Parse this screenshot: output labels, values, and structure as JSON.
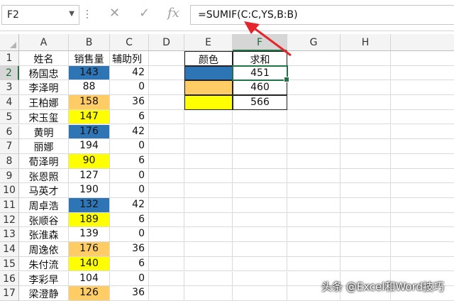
{
  "name_box": "F2",
  "formula": "=SUMIF(C:C,YS,B:B)",
  "formula_icons": {
    "cancel": "✕",
    "enter": "✓",
    "function": "fx"
  },
  "columns": [
    "A",
    "B",
    "C",
    "D",
    "E",
    "F",
    "G",
    "H"
  ],
  "rows": [
    1,
    2,
    3,
    4,
    5,
    6,
    7,
    8,
    9,
    10,
    11,
    12,
    13,
    14,
    15,
    16,
    17
  ],
  "colors": {
    "blue": "#2e75b6",
    "orange": "#ffcc66",
    "yellow": "#ffff00",
    "selection": "#217346"
  },
  "table_main": {
    "headers": [
      "姓名",
      "销售量",
      "辅助列"
    ],
    "rows": [
      {
        "name": "杨国忠",
        "sales": "143",
        "aux": "42",
        "fill": "blue"
      },
      {
        "name": "李泽明",
        "sales": "88",
        "aux": "0",
        "fill": ""
      },
      {
        "name": "王柏娜",
        "sales": "158",
        "aux": "36",
        "fill": "orange"
      },
      {
        "name": "宋玉玺",
        "sales": "147",
        "aux": "6",
        "fill": "yellow"
      },
      {
        "name": "黄明",
        "sales": "176",
        "aux": "42",
        "fill": "blue"
      },
      {
        "name": "丽娜",
        "sales": "194",
        "aux": "0",
        "fill": ""
      },
      {
        "name": "荀泽明",
        "sales": "90",
        "aux": "6",
        "fill": "yellow"
      },
      {
        "name": "张恩照",
        "sales": "127",
        "aux": "0",
        "fill": ""
      },
      {
        "name": "马英才",
        "sales": "190",
        "aux": "0",
        "fill": ""
      },
      {
        "name": "周卓浩",
        "sales": "132",
        "aux": "42",
        "fill": "blue"
      },
      {
        "name": "张顺谷",
        "sales": "189",
        "aux": "6",
        "fill": "yellow"
      },
      {
        "name": "张淮森",
        "sales": "139",
        "aux": "0",
        "fill": ""
      },
      {
        "name": "周逸依",
        "sales": "176",
        "aux": "36",
        "fill": "orange"
      },
      {
        "name": "朱付流",
        "sales": "140",
        "aux": "6",
        "fill": "yellow"
      },
      {
        "name": "李彩早",
        "sales": "104",
        "aux": "0",
        "fill": ""
      },
      {
        "name": "梁澄静",
        "sales": "126",
        "aux": "36",
        "fill": "orange"
      }
    ]
  },
  "summary": {
    "headers": [
      "颜色",
      "求和"
    ],
    "rows": [
      {
        "fill": "blue",
        "sum": "451"
      },
      {
        "fill": "orange",
        "sum": "460"
      },
      {
        "fill": "yellow",
        "sum": "566"
      }
    ]
  },
  "watermark": "头条 @Excel和Word技巧"
}
